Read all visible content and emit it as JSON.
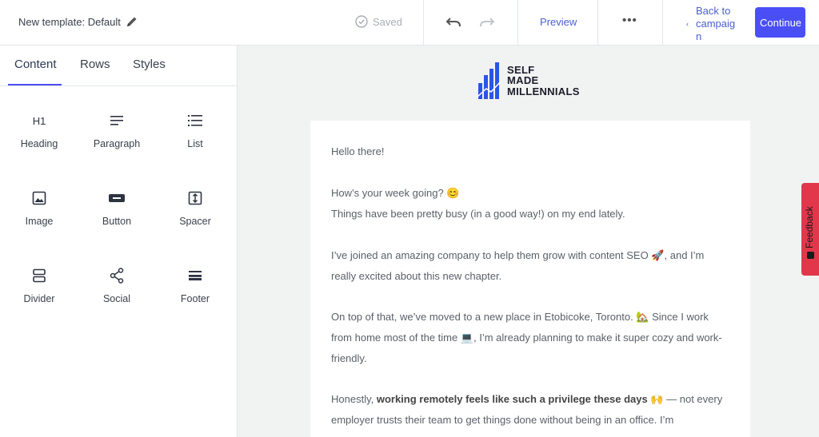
{
  "topbar": {
    "template_title": "New template: Default",
    "saved_label": "Saved",
    "preview_label": "Preview",
    "more_label": "•••",
    "back_label": "Back to campaign",
    "continue_label": "Continue"
  },
  "panel": {
    "tabs": [
      {
        "label": "Content"
      },
      {
        "label": "Rows"
      },
      {
        "label": "Styles"
      }
    ],
    "blocks": [
      {
        "label": "Heading",
        "icon": "heading-icon",
        "glyph": "H1"
      },
      {
        "label": "Paragraph",
        "icon": "paragraph-icon"
      },
      {
        "label": "List",
        "icon": "list-icon"
      },
      {
        "label": "Image",
        "icon": "image-icon"
      },
      {
        "label": "Button",
        "icon": "button-icon"
      },
      {
        "label": "Spacer",
        "icon": "spacer-icon"
      },
      {
        "label": "Divider",
        "icon": "divider-icon"
      },
      {
        "label": "Social",
        "icon": "share-icon"
      },
      {
        "label": "Footer",
        "icon": "footer-icon"
      }
    ]
  },
  "logo": {
    "line1": "SELF",
    "line2": "MADE",
    "line3": "MILLENNIALS"
  },
  "email": {
    "greeting": "Hello there!",
    "week_question": "How’s your week going? 😊",
    "busy": "Things have been pretty busy (in a good way!) on my end lately.",
    "joined": "I’ve joined an amazing company to help them grow with content SEO 🚀, and I’m really excited about this new chapter.",
    "moved": "On top of that, we’ve moved to a new place in Etobicoke, Toronto. 🏡 Since I work from home most of the time 💻, I’m already planning to make it super cozy and work-friendly.",
    "honestly_prefix": "Honestly, ",
    "honestly_bold": "working remotely feels like such a privilege these days 🙌",
    "honestly_suffix": " — not every employer trusts their team to get things done without being in an office. I’m"
  },
  "feedback_label": "Feedback",
  "colors": {
    "accent": "#4a4ff5",
    "link": "#4b5ed1",
    "feedback": "#e2374b",
    "logo_blue": "#2b55e6"
  }
}
